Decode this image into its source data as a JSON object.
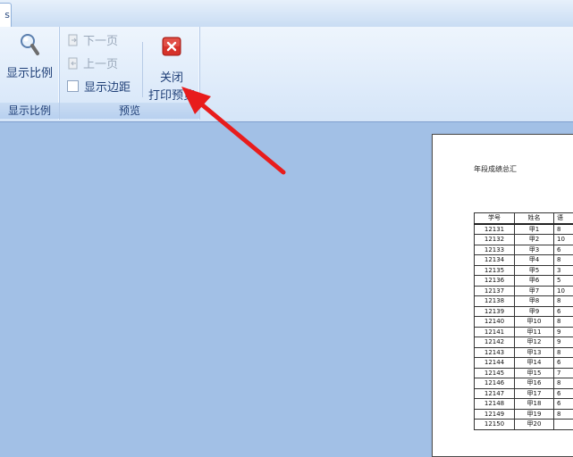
{
  "ribbon": {
    "zoom_group": {
      "zoom_button_label": "显示比例",
      "group_label": "显示比例"
    },
    "preview_group": {
      "next_page_label": "下一页",
      "prev_page_label": "上一页",
      "show_margins_label": "显示边距",
      "close_label_line1": "关闭",
      "close_label_line2": "打印预览",
      "group_label": "预览"
    }
  },
  "document": {
    "title": "年段成绩总汇",
    "columns": [
      "学号",
      "姓名",
      "语"
    ],
    "rows": [
      [
        "12131",
        "甲1",
        "8"
      ],
      [
        "12132",
        "甲2",
        "10"
      ],
      [
        "12133",
        "甲3",
        "6"
      ],
      [
        "12134",
        "甲4",
        "8"
      ],
      [
        "12135",
        "甲5",
        "3"
      ],
      [
        "12136",
        "甲6",
        "5"
      ],
      [
        "12137",
        "甲7",
        "10"
      ],
      [
        "12138",
        "甲8",
        "8"
      ],
      [
        "12139",
        "甲9",
        "6"
      ],
      [
        "12140",
        "甲10",
        "8"
      ],
      [
        "12141",
        "甲11",
        "9"
      ],
      [
        "12142",
        "甲12",
        "9"
      ],
      [
        "12143",
        "甲13",
        "8"
      ],
      [
        "12144",
        "甲14",
        "6"
      ],
      [
        "12145",
        "甲15",
        "7"
      ],
      [
        "12146",
        "甲16",
        "8"
      ],
      [
        "12147",
        "甲17",
        "6"
      ],
      [
        "12148",
        "甲18",
        "6"
      ],
      [
        "12149",
        "甲19",
        "8"
      ],
      [
        "12150",
        "甲20",
        ""
      ]
    ]
  },
  "colors": {
    "workspace": "#a2c0e6",
    "arrow": "#e81c1c",
    "ribbon_text": "#1f3f77"
  },
  "icons": [
    "magnifier-icon",
    "next-page-icon",
    "prev-page-icon",
    "close-preview-icon"
  ]
}
